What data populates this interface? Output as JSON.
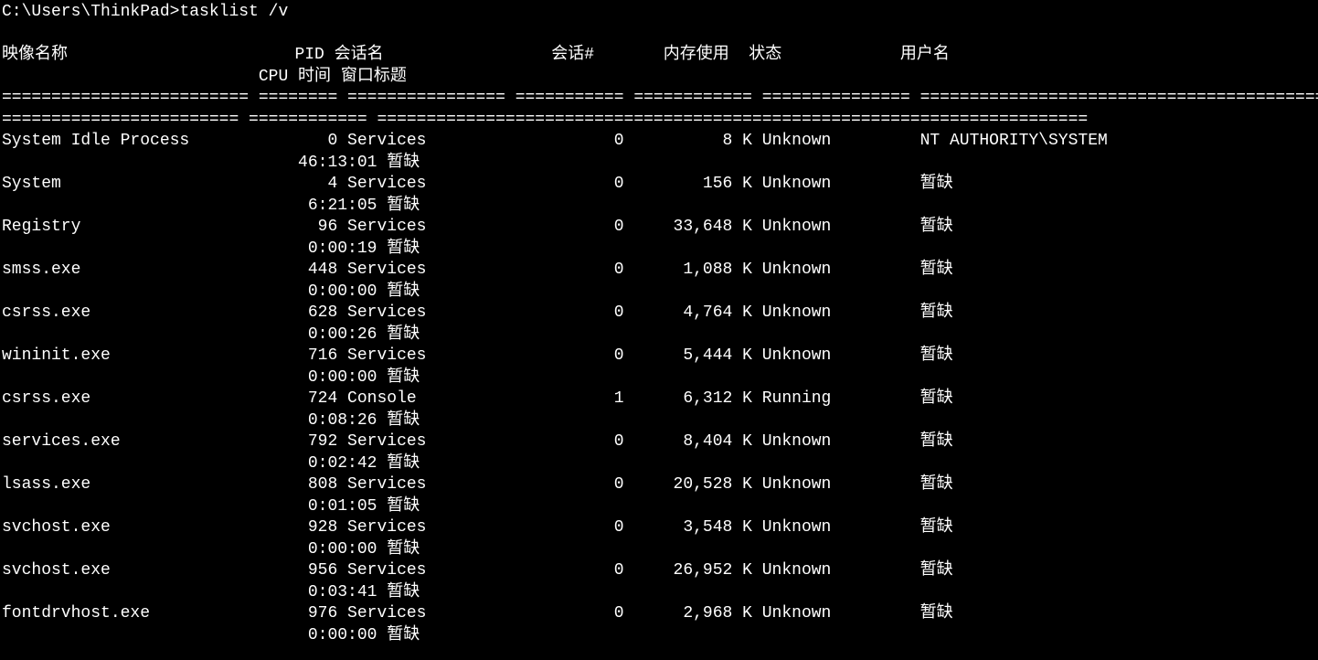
{
  "prompt": "C:\\Users\\ThinkPad>",
  "command": "tasklist /v",
  "header": {
    "line1": "映像名称                       PID 会话名                 会话#       内存使用  状态            用户名",
    "line2": "                          CPU 时间 窗口标题"
  },
  "divider1": "========================= ======== ================ =========== ============ =============== ================================================",
  "divider2": "======================== ============ ========================================================================",
  "columns": [
    "image_name",
    "pid",
    "session_name",
    "session_num",
    "mem_usage",
    "status",
    "user_name",
    "cpu_time",
    "window_title"
  ],
  "rows": [
    {
      "image_name": "System Idle Process",
      "pid": "0",
      "session_name": "Services",
      "session_num": "0",
      "mem_usage": "8 K",
      "status": "Unknown",
      "user_name": "NT AUTHORITY\\SYSTEM",
      "cpu_time": "46:13:01",
      "window_title": "暂缺"
    },
    {
      "image_name": "System",
      "pid": "4",
      "session_name": "Services",
      "session_num": "0",
      "mem_usage": "156 K",
      "status": "Unknown",
      "user_name": "暂缺",
      "cpu_time": "6:21:05",
      "window_title": "暂缺"
    },
    {
      "image_name": "Registry",
      "pid": "96",
      "session_name": "Services",
      "session_num": "0",
      "mem_usage": "33,648 K",
      "status": "Unknown",
      "user_name": "暂缺",
      "cpu_time": "0:00:19",
      "window_title": "暂缺"
    },
    {
      "image_name": "smss.exe",
      "pid": "448",
      "session_name": "Services",
      "session_num": "0",
      "mem_usage": "1,088 K",
      "status": "Unknown",
      "user_name": "暂缺",
      "cpu_time": "0:00:00",
      "window_title": "暂缺"
    },
    {
      "image_name": "csrss.exe",
      "pid": "628",
      "session_name": "Services",
      "session_num": "0",
      "mem_usage": "4,764 K",
      "status": "Unknown",
      "user_name": "暂缺",
      "cpu_time": "0:00:26",
      "window_title": "暂缺"
    },
    {
      "image_name": "wininit.exe",
      "pid": "716",
      "session_name": "Services",
      "session_num": "0",
      "mem_usage": "5,444 K",
      "status": "Unknown",
      "user_name": "暂缺",
      "cpu_time": "0:00:00",
      "window_title": "暂缺"
    },
    {
      "image_name": "csrss.exe",
      "pid": "724",
      "session_name": "Console",
      "session_num": "1",
      "mem_usage": "6,312 K",
      "status": "Running",
      "user_name": "暂缺",
      "cpu_time": "0:08:26",
      "window_title": "暂缺"
    },
    {
      "image_name": "services.exe",
      "pid": "792",
      "session_name": "Services",
      "session_num": "0",
      "mem_usage": "8,404 K",
      "status": "Unknown",
      "user_name": "暂缺",
      "cpu_time": "0:02:42",
      "window_title": "暂缺"
    },
    {
      "image_name": "lsass.exe",
      "pid": "808",
      "session_name": "Services",
      "session_num": "0",
      "mem_usage": "20,528 K",
      "status": "Unknown",
      "user_name": "暂缺",
      "cpu_time": "0:01:05",
      "window_title": "暂缺"
    },
    {
      "image_name": "svchost.exe",
      "pid": "928",
      "session_name": "Services",
      "session_num": "0",
      "mem_usage": "3,548 K",
      "status": "Unknown",
      "user_name": "暂缺",
      "cpu_time": "0:00:00",
      "window_title": "暂缺"
    },
    {
      "image_name": "svchost.exe",
      "pid": "956",
      "session_name": "Services",
      "session_num": "0",
      "mem_usage": "26,952 K",
      "status": "Unknown",
      "user_name": "暂缺",
      "cpu_time": "0:03:41",
      "window_title": "暂缺"
    },
    {
      "image_name": "fontdrvhost.exe",
      "pid": "976",
      "session_name": "Services",
      "session_num": "0",
      "mem_usage": "2,968 K",
      "status": "Unknown",
      "user_name": "暂缺",
      "cpu_time": "0:00:00",
      "window_title": "暂缺"
    }
  ],
  "widths": {
    "image_name": 25,
    "pid": 8,
    "session_name": 16,
    "session_num": 11,
    "mem_usage": 12,
    "status": 15,
    "user_name": 48,
    "cpu_time": 12,
    "window_title": 40,
    "line2_lead": 25
  }
}
